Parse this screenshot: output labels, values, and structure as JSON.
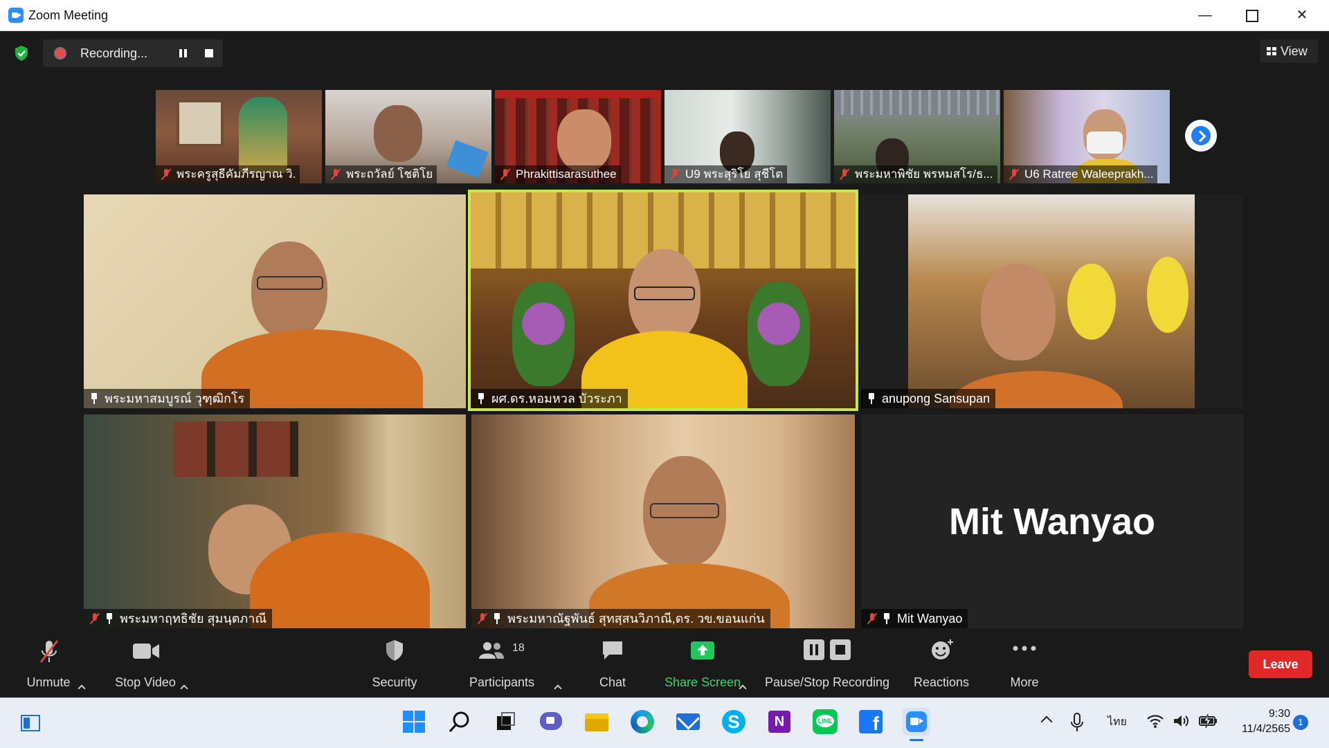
{
  "window": {
    "title": "Zoom Meeting",
    "minimize": "—",
    "close": "✕"
  },
  "recording": {
    "label": "Recording..."
  },
  "view": {
    "label": "View"
  },
  "thumbnails": [
    {
      "name": "พระครูสุธีคัมภีรญาณ วิ."
    },
    {
      "name": "พระถวัลย์ โชติโย"
    },
    {
      "name": "Phrakittisarasuthee"
    },
    {
      "name": "U9 พระสุริโย สุชีโต"
    },
    {
      "name": "พระมหาพิชัย พรหมสโร/ธ..."
    },
    {
      "name": "U6 Ratree Waleeprakh..."
    }
  ],
  "tiles": [
    {
      "name": "พระมหาสมบูรณ์ วุฑฺฒิกโร"
    },
    {
      "name": "ผศ.ดร.หอมหวล บัวระภา"
    },
    {
      "name": "anupong Sansupan"
    },
    {
      "name": "พระมหาฤทธิชัย สุมนฺตภาณี"
    },
    {
      "name": "พระมหาณัฐพันธ์ สุทสฺสนวิภาณี,ดร. วข.ขอนแก่น"
    },
    {
      "name": "Mit Wanyao",
      "display": "Mit Wanyao"
    }
  ],
  "toolbar": {
    "unmute": "Unmute",
    "stop_video": "Stop Video",
    "security": "Security",
    "participants": "Participants",
    "participants_count": "18",
    "chat": "Chat",
    "share_screen": "Share Screen",
    "pause_stop_recording": "Pause/Stop Recording",
    "reactions": "Reactions",
    "more": "More",
    "leave": "Leave"
  },
  "taskbar": {
    "language": "ไทย",
    "time": "9:30",
    "date": "11/4/2565",
    "notifications": "1"
  },
  "colors": {
    "accent": "#2d8cff",
    "leave": "#e02828",
    "active_speaker": "#c9e84a",
    "share_screen": "#22c55e"
  }
}
